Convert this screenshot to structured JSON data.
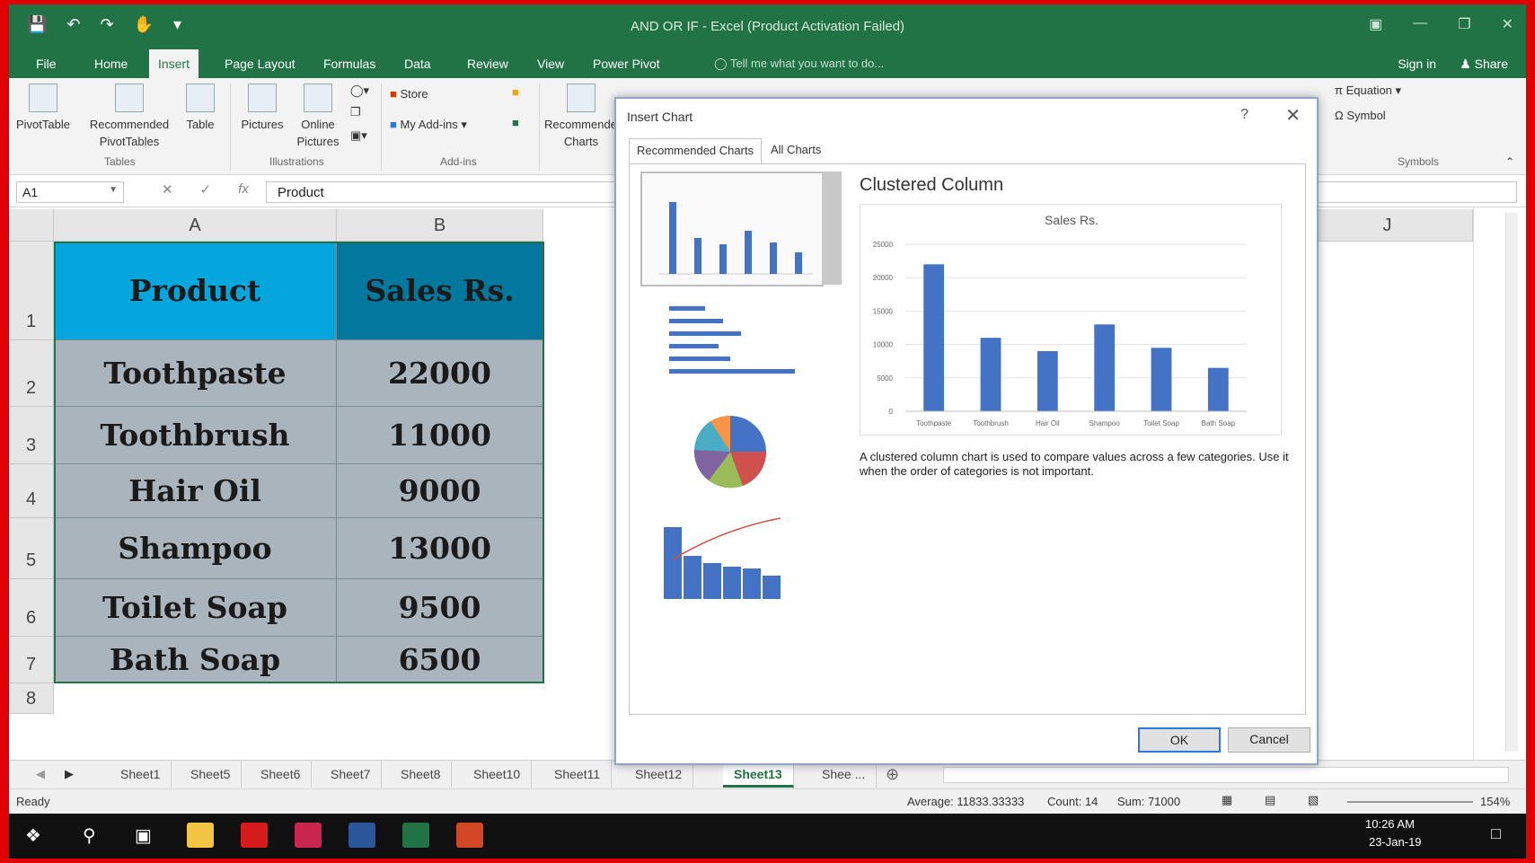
{
  "window": {
    "title": "AND OR IF - Excel (Product Activation Failed)",
    "sign_in": "Sign in",
    "share": "Share",
    "tell_me": "Tell me what you want to do..."
  },
  "menu": {
    "tabs": [
      "File",
      "Home",
      "Insert",
      "Page Layout",
      "Formulas",
      "Data",
      "Review",
      "View",
      "Power Pivot"
    ],
    "active": "Insert"
  },
  "ribbon": {
    "pivottable": "PivotTable",
    "recommended_pivot": "Recommended PivotTables",
    "table": "Table",
    "pictures": "Pictures",
    "online_pictures": "Online Pictures",
    "store": "Store",
    "my_addins": "My Add-ins",
    "recommended_charts": "Recommended Charts",
    "equation": "Equation",
    "symbol": "Symbol",
    "group_tables": "Tables",
    "group_illustrations": "Illustrations",
    "group_addins": "Add-ins",
    "group_symbols": "Symbols"
  },
  "formula_bar": {
    "name_box": "A1",
    "fx": "fx",
    "content": "Product"
  },
  "grid": {
    "columns": [
      "A",
      "B",
      "J"
    ],
    "rows": [
      "1",
      "2",
      "3",
      "4",
      "5",
      "6",
      "7",
      "8"
    ],
    "header": {
      "product": "Product",
      "sales": "Sales Rs."
    },
    "data": [
      {
        "product": "Toothpaste",
        "sales": "22000"
      },
      {
        "product": "Toothbrush",
        "sales": "11000"
      },
      {
        "product": "Hair Oil",
        "sales": "9000"
      },
      {
        "product": "Shampoo",
        "sales": "13000"
      },
      {
        "product": "Toilet Soap",
        "sales": "9500"
      },
      {
        "product": "Bath Soap",
        "sales": "6500"
      }
    ]
  },
  "sheets": {
    "tabs": [
      "Sheet1",
      "Sheet5",
      "Sheet6",
      "Sheet7",
      "Sheet8",
      "Sheet10",
      "Sheet11",
      "Sheet12",
      "Sheet13",
      "Shee ..."
    ],
    "active": "Sheet13"
  },
  "status": {
    "ready": "Ready",
    "average": "Average: 11833.33333",
    "count": "Count: 14",
    "sum": "Sum: 71000",
    "zoom": "154%"
  },
  "taskbar": {
    "time": "10:26 AM",
    "date": "23-Jan-19"
  },
  "dialog": {
    "title": "Insert Chart",
    "help": "?",
    "close": "✕",
    "tab_recommended": "Recommended Charts",
    "tab_all": "All Charts",
    "preview_title": "Clustered Column",
    "description": "A clustered column chart is used to compare values across a few categories. Use it when the order of categories is not important.",
    "ok": "OK",
    "cancel": "Cancel"
  },
  "chart_data": {
    "type": "bar",
    "title": "Sales Rs.",
    "categories": [
      "Toothpaste",
      "Toothbrush",
      "Hair Oil",
      "Shampoo",
      "Toilet Soap",
      "Bath Soap"
    ],
    "values": [
      22000,
      11000,
      9000,
      13000,
      9500,
      6500
    ],
    "yticks": [
      "25000",
      "20000",
      "15000",
      "10000",
      "5000",
      "0"
    ],
    "ylim": [
      0,
      25000
    ],
    "bar_color": "#4472c4",
    "grid": true
  },
  "colors": {
    "excel_green": "#217346",
    "header_a": "#03a7dd",
    "header_b": "#02789e",
    "data_fill": "#a9b4bc",
    "frame_red": "#e00000"
  }
}
